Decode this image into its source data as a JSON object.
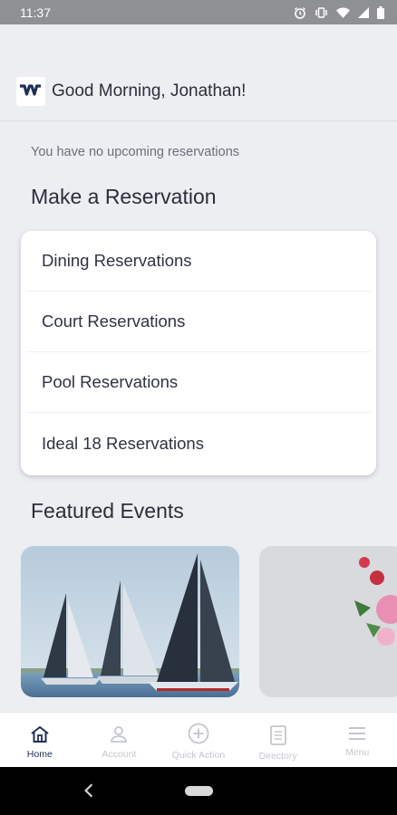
{
  "status_bar": {
    "time": "11:37",
    "icons": [
      "alarm-icon",
      "vibrate-icon",
      "wifi-icon",
      "signal-icon",
      "battery-icon"
    ]
  },
  "header": {
    "logo_icon": "club-logo-icon",
    "greeting": "Good Morning, Jonathan!"
  },
  "reservations": {
    "empty_text": "You have no upcoming reservations",
    "section_title": "Make a Reservation",
    "items": [
      {
        "label": "Dining Reservations"
      },
      {
        "label": "Court Reservations"
      },
      {
        "label": "Pool Reservations"
      },
      {
        "label": "Ideal 18 Reservations"
      }
    ]
  },
  "events": {
    "section_title": "Featured Events",
    "cards": [
      {
        "image": "sailboats-photo"
      },
      {
        "image": "flowers-photo"
      }
    ]
  },
  "bottom_nav": {
    "active": "Home",
    "items": [
      {
        "label": "Home",
        "icon": "home-icon"
      },
      {
        "label": "Account",
        "icon": "person-icon"
      },
      {
        "label": "Quick Action",
        "icon": "plus-circle-icon"
      },
      {
        "label": "Directory",
        "icon": "directory-icon"
      },
      {
        "label": "Menu",
        "icon": "menu-icon"
      }
    ]
  },
  "colors": {
    "accent": "#1f2f58",
    "background": "#eceef2",
    "status_bar": "#8f9094"
  }
}
